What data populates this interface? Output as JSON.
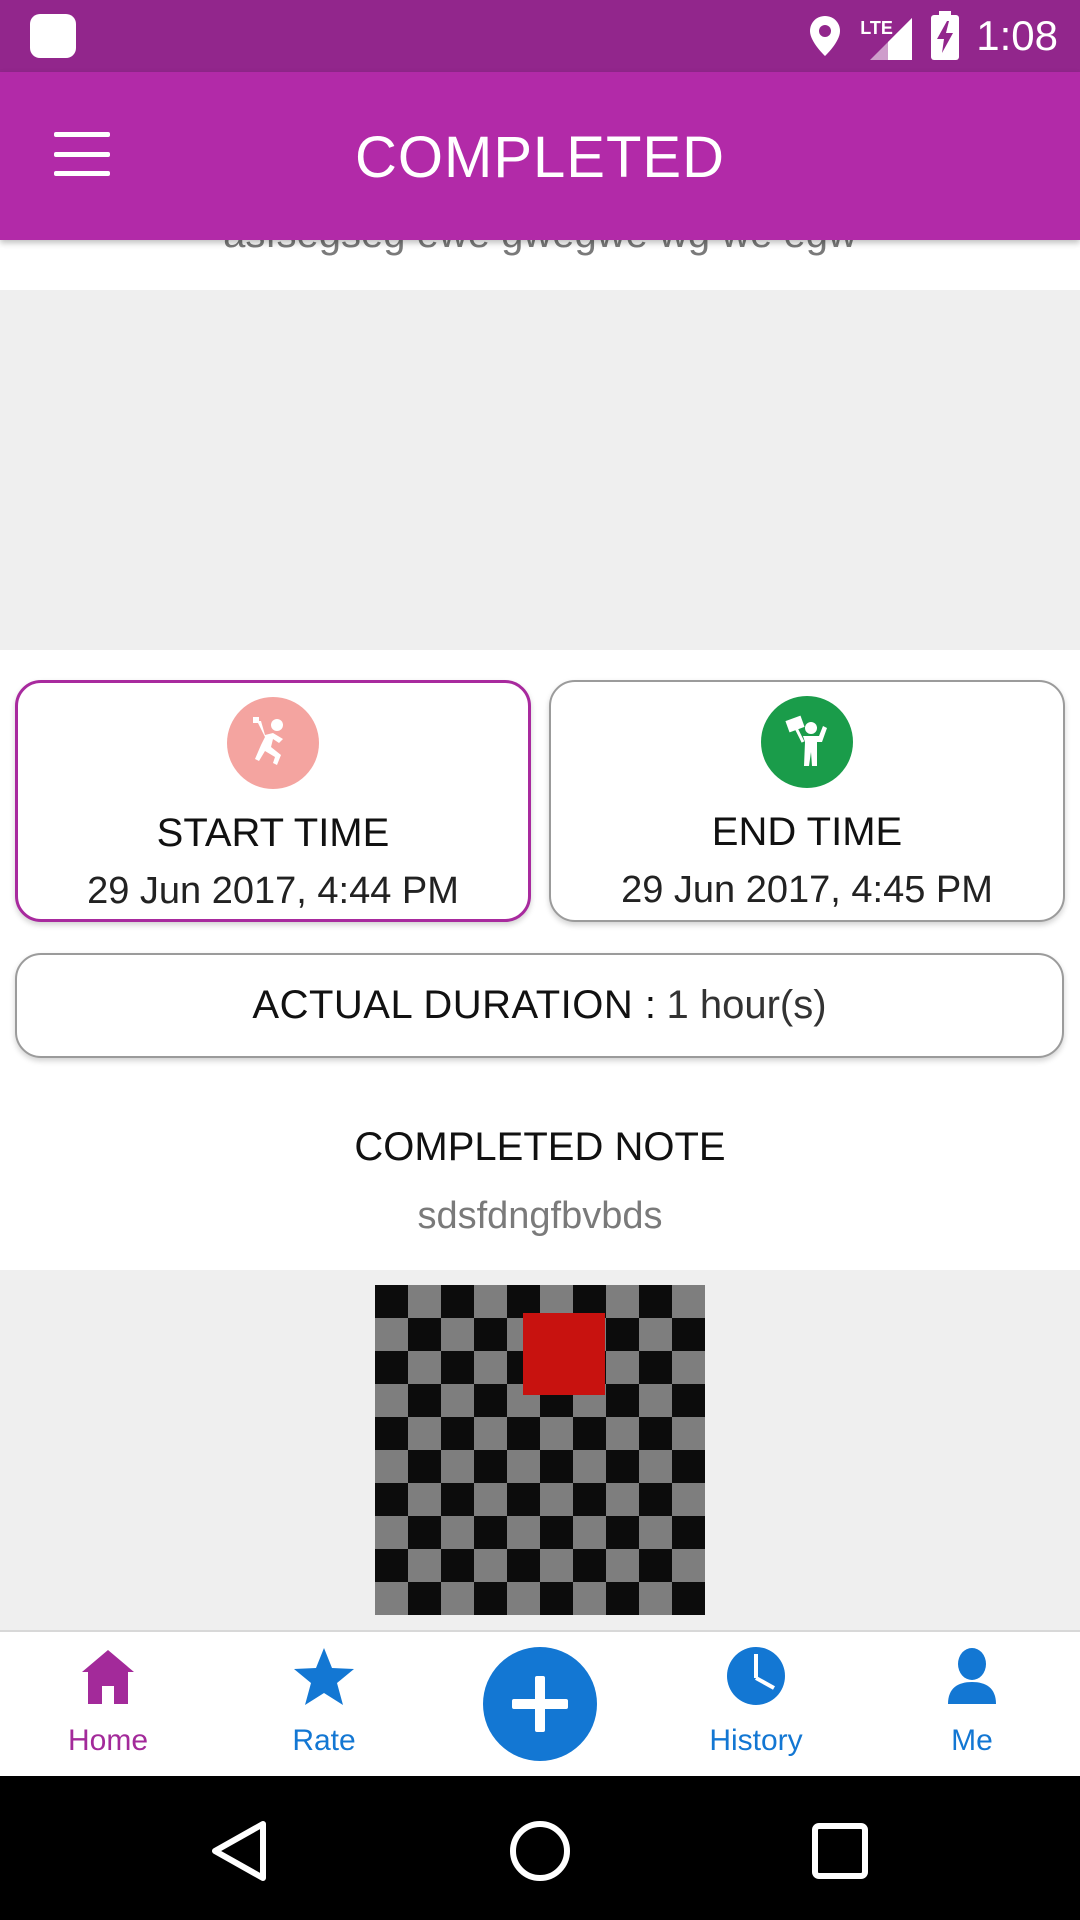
{
  "status_bar": {
    "time": "1:08",
    "network": "LTE",
    "icons": [
      "location-icon",
      "signal-icon",
      "battery-charging-icon"
    ]
  },
  "app_bar": {
    "title": "COMPLETED",
    "menu_icon": "menu-icon"
  },
  "description": {
    "text": "asfsegseg ewe gwegwe wg  we egw"
  },
  "start_time": {
    "label": "START TIME",
    "value": "29 Jun 2017, 4:44 PM",
    "icon": "runner-icon"
  },
  "end_time": {
    "label": "END TIME",
    "value": "29 Jun 2017, 4:45 PM",
    "icon": "finish-flag-icon"
  },
  "duration": {
    "label": "ACTUAL DURATION :",
    "value": "1 hour(s)"
  },
  "completed_note": {
    "title": "COMPLETED NOTE",
    "text": "sdsfdngfbvbds"
  },
  "bottom_nav": {
    "items": [
      {
        "label": "Home",
        "icon": "home-icon"
      },
      {
        "label": "Rate",
        "icon": "star-icon"
      },
      {
        "label": "",
        "icon": "add-icon"
      },
      {
        "label": "History",
        "icon": "clock-icon"
      },
      {
        "label": "Me",
        "icon": "person-icon"
      }
    ]
  },
  "colors": {
    "status_bar": "#92268c",
    "app_bar": "#b22aa8",
    "accent_blue": "#1377d3",
    "active_nav": "#a32a9a",
    "start_icon_bg": "#f4a4a0",
    "end_icon_bg": "#1a9c4a"
  }
}
